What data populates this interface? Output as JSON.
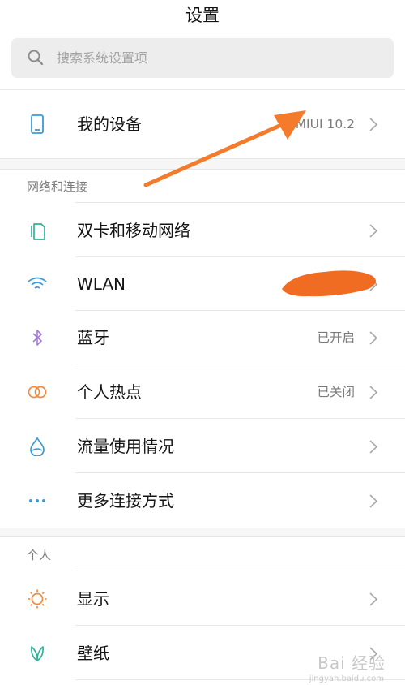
{
  "header": {
    "title": "设置"
  },
  "search": {
    "placeholder": "搜索系统设置项"
  },
  "my_device": {
    "label": "我的设备",
    "value": "MIUI 10.2"
  },
  "sections": {
    "network": {
      "header": "网络和连接",
      "items": [
        {
          "label": "双卡和移动网络",
          "value": "",
          "icon": "dual-sim-icon"
        },
        {
          "label": "WLAN",
          "value": "",
          "icon": "wifi-icon"
        },
        {
          "label": "蓝牙",
          "value": "已开启",
          "icon": "bluetooth-icon"
        },
        {
          "label": "个人热点",
          "value": "已关闭",
          "icon": "hotspot-icon"
        },
        {
          "label": "流量使用情况",
          "value": "",
          "icon": "data-usage-icon"
        },
        {
          "label": "更多连接方式",
          "value": "",
          "icon": "more-icon"
        }
      ]
    },
    "personal": {
      "header": "个人",
      "items": [
        {
          "label": "显示",
          "icon": "display-icon"
        },
        {
          "label": "壁纸",
          "icon": "wallpaper-icon"
        }
      ]
    }
  },
  "colors": {
    "arrow": "#f47a2c",
    "redaction": "#f06c22",
    "icon_blue": "#3a9bd9",
    "icon_teal": "#30b39a",
    "icon_purple": "#a37be0",
    "icon_orange": "#f08a3c"
  },
  "watermark": {
    "text": "Bai 经验",
    "sub": "jingyan.baidu.com"
  }
}
